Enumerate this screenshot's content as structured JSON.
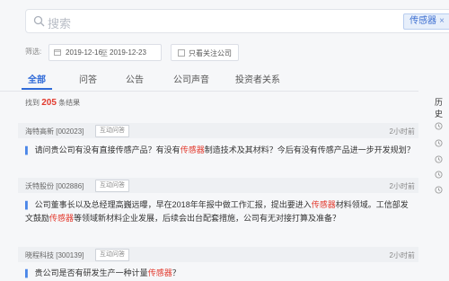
{
  "search": {
    "placeholder": "搜索",
    "tag_label": "传感器",
    "tag_close": "×"
  },
  "filters": {
    "label": "筛选:",
    "date_start": "2019-12-16",
    "date_sep": "至",
    "date_end": "2019-12-23",
    "follow_only_label": "只看关注公司"
  },
  "tabs": [
    {
      "label": "全部",
      "active": true
    },
    {
      "label": "问答",
      "active": false
    },
    {
      "label": "公告",
      "active": false
    },
    {
      "label": "公司声音",
      "active": false
    },
    {
      "label": "投资者关系",
      "active": false
    }
  ],
  "results": {
    "prefix": "找到",
    "count": "205",
    "suffix": "条结果"
  },
  "items": [
    {
      "company": "海特高新 [002023]",
      "badge": "互动问答",
      "time": "2小时前",
      "q_pre": "请问贵公司有没有直接传感产品？有没有",
      "q_hl": "传感器",
      "q_post": "制造技术及其材料？今后有没有传感产品进一步开发规划？"
    },
    {
      "company": "沃特股份 [002886]",
      "badge": "互动问答",
      "time": "2小时前",
      "q_pre": "公司董事长以及总经理高巍远曝，早在2018年年报中做工作汇报，提出要进入",
      "q_hl": "传感器",
      "q_post": "材料领域。工信部发文鼓励",
      "q2_hl": "传感器",
      "q2_post": "等领域新材料企业发展，后续会出台配套措施，公司有无对接打算及准备？"
    },
    {
      "company": "晓程科技 [300139]",
      "badge": "互动问答",
      "time": "2小时前",
      "q_pre": "贵公司是否有研发生产一种计量",
      "q_hl": "传感器",
      "q_post": "？"
    }
  ],
  "sidebar": {
    "title": "历史"
  }
}
